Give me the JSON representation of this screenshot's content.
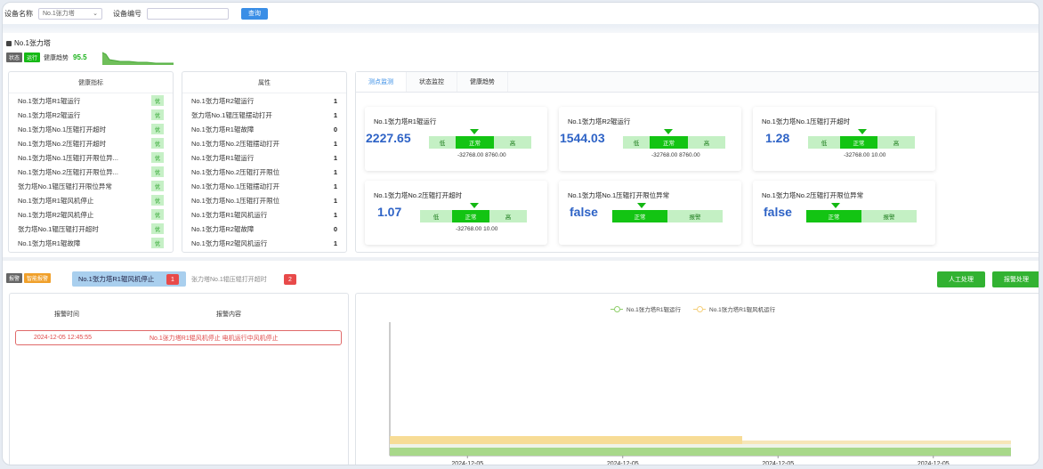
{
  "topbar": {
    "device_name_label": "设备名称",
    "device_name_value": "No.1张力塔",
    "device_code_label": "设备编号",
    "device_code_placeholder": "",
    "search_label": "查询"
  },
  "device": {
    "title": "No.1张力塔",
    "status_tag": "状态",
    "status_value": "运行",
    "health_label": "健康趋势",
    "health_value": "95.5"
  },
  "health_panel": {
    "title": "健康指标",
    "rows": [
      {
        "label": "No.1张力塔R1辊运行",
        "value": "优"
      },
      {
        "label": "No.1张力塔R2辊运行",
        "value": "优"
      },
      {
        "label": "No.1张力塔No.1压辊打开超时",
        "value": "优"
      },
      {
        "label": "No.1张力塔No.2压辊打开超时",
        "value": "优"
      },
      {
        "label": "No.1张力塔No.1压辊打开限位异...",
        "value": "优"
      },
      {
        "label": "No.1张力塔No.2压辊打开限位异...",
        "value": "优"
      },
      {
        "label": "张力塔No.1辊压辊打开限位异常",
        "value": "优"
      },
      {
        "label": "No.1张力塔R1辊风机停止",
        "value": "优"
      },
      {
        "label": "No.1张力塔R2辊风机停止",
        "value": "优"
      },
      {
        "label": "张力塔No.1辊压辊打开超时",
        "value": "优"
      },
      {
        "label": "No.1张力塔R1辊故障",
        "value": "优"
      }
    ]
  },
  "attr_panel": {
    "title": "属性",
    "rows": [
      {
        "label": "No.1张力塔R2辊运行",
        "value": "1"
      },
      {
        "label": "张力塔No.1辊压辊摆动打开",
        "value": "1"
      },
      {
        "label": "No.1张力塔R1辊故障",
        "value": "0"
      },
      {
        "label": "No.1张力塔No.2压辊摆动打开",
        "value": "1"
      },
      {
        "label": "No.1张力塔R1辊运行",
        "value": "1"
      },
      {
        "label": "No.1张力塔No.2压辊打开限位",
        "value": "1"
      },
      {
        "label": "No.1张力塔No.1压辊摆动打开",
        "value": "1"
      },
      {
        "label": "No.1张力塔No.1压辊打开限位",
        "value": "1"
      },
      {
        "label": "No.1张力塔R1辊风机运行",
        "value": "1"
      },
      {
        "label": "No.1张力塔R2辊故障",
        "value": "0"
      },
      {
        "label": "No.1张力塔R2辊风机运行",
        "value": "1"
      }
    ]
  },
  "monitor": {
    "tabs": [
      "测点监测",
      "状态监控",
      "健康趋势"
    ],
    "active_tab": 0,
    "low_label": "低",
    "normal_label": "正常",
    "high_label": "高",
    "alarm_label": "报警",
    "cards": [
      {
        "title": "No.1张力塔R1辊运行",
        "value": "2227.65",
        "type": "range",
        "min": "-32768.00",
        "max": "8760.00"
      },
      {
        "title": "No.1张力塔R2辊运行",
        "value": "1544.03",
        "type": "range",
        "min": "-32768.00",
        "max": "8760.00"
      },
      {
        "title": "No.1张力塔No.1压辊打开超时",
        "value": "1.28",
        "type": "range",
        "min": "-32768.00",
        "max": "10.00"
      },
      {
        "title": "No.1张力塔No.2压辊打开超时",
        "value": "1.07",
        "type": "range",
        "min": "-32768.00",
        "max": "10.00"
      },
      {
        "title": "No.1张力塔No.1压辊打开限位异常",
        "value": "false",
        "type": "bool"
      },
      {
        "title": "No.1张力塔No.2压辊打开限位异常",
        "value": "false",
        "type": "bool"
      }
    ]
  },
  "alarm": {
    "tag1": "报警",
    "tag2": "智能报警",
    "tabs": [
      {
        "label": "No.1张力塔R1辊风机停止",
        "count": "1"
      },
      {
        "label": "张力塔No.1辊压辊打开超时",
        "count": "2"
      }
    ],
    "manual_button": "人工处理",
    "alarm_button": "报警处理",
    "table_headers": [
      "报警时间",
      "报警内容"
    ],
    "rows": [
      {
        "time": "2024-12-05 12:45:55",
        "content": "No.1张力塔R1辊风机停止 电机运行中风机停止"
      }
    ]
  },
  "chart_data": {
    "type": "area",
    "series": [
      {
        "name": "No.1张力塔R1辊运行",
        "color": "#8fcf6a"
      },
      {
        "name": "No.1张力塔R1辊风机运行",
        "color": "#f5cf7a"
      }
    ],
    "x_ticks": [
      "2024-12-05",
      "2024-12-05",
      "2024-12-05",
      "2024-12-05"
    ]
  },
  "colors": {
    "accent": "#3a8ee6",
    "ok_green": "#13c413",
    "alarm_red": "#e84a4a",
    "value_blue": "#2e63c6"
  }
}
